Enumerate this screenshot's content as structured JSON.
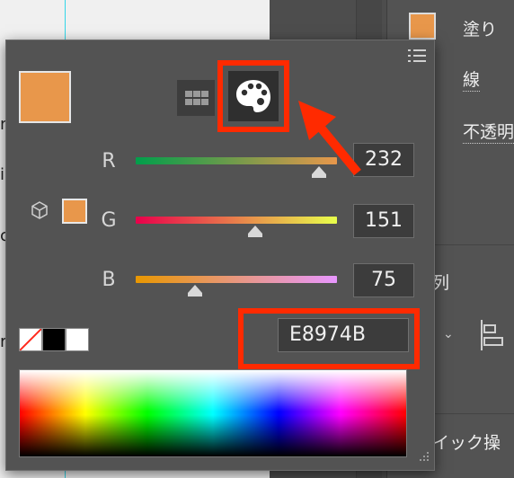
{
  "canvas": {
    "partial_text": [
      "n",
      "i",
      "c",
      "r"
    ]
  },
  "properties_panel": {
    "fill_label": "塗り",
    "stroke_label": "線",
    "opacity_label": "不透明",
    "align_label": "列",
    "quick_actions_label": "イック操"
  },
  "color_picker": {
    "mode_buttons": [
      "grid-mode",
      "palette-mode"
    ],
    "active_mode": "palette-mode",
    "current_color": "#E8974B",
    "sliders": [
      {
        "label": "R",
        "value": "232",
        "fraction": 0.909
      },
      {
        "label": "G",
        "value": "151",
        "fraction": 0.592
      },
      {
        "label": "B",
        "value": "75",
        "fraction": 0.294
      }
    ],
    "quick_swatches": [
      "none",
      "#000000",
      "#FFFFFF"
    ],
    "hex_label": "#",
    "hex_value": "E8974B"
  },
  "annotation": {
    "highlight_color": "#FF2A00"
  }
}
